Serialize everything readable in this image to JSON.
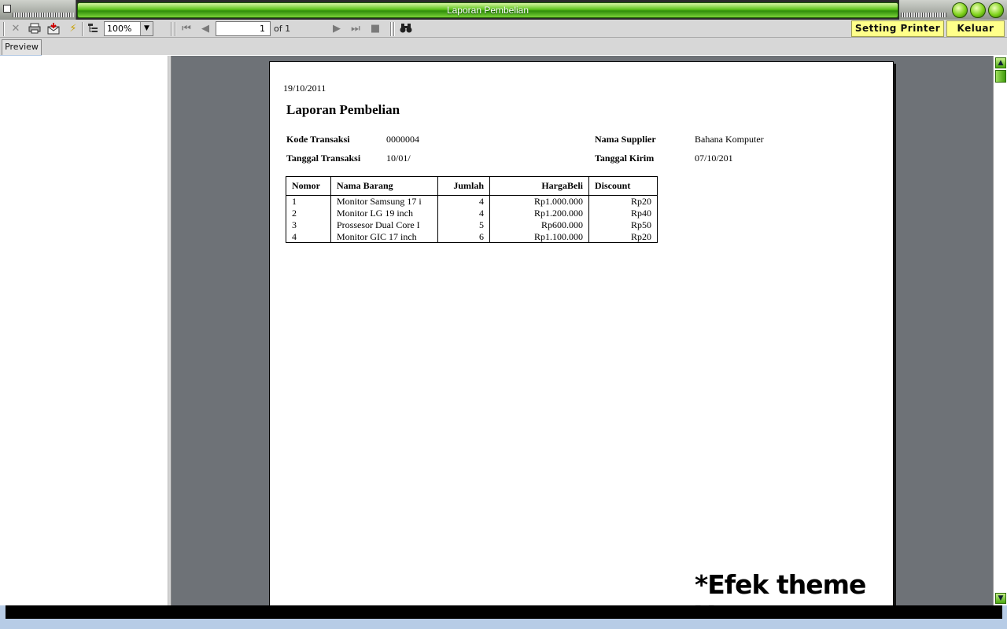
{
  "window": {
    "title": "Laporan Pembelian"
  },
  "toolbar": {
    "zoom": "100%",
    "page_current": "1",
    "page_of": "of 1",
    "setting_printer_label": "Setting Printer",
    "exit_label": "Keluar"
  },
  "tabs": [
    {
      "label": "Preview"
    }
  ],
  "report": {
    "date": "19/10/2011",
    "title": "Laporan Pembelian",
    "kode_label": "Kode Transaksi",
    "kode_value": "0000004",
    "tanggal_label": "Tanggal Transaksi",
    "tanggal_value": "10/01/",
    "supplier_label": "Nama Supplier",
    "supplier_value": "Bahana Komputer",
    "kirim_label": "Tanggal Kirim",
    "kirim_value": "07/10/201",
    "columns": [
      "Nomor",
      "Nama Barang",
      "Jumlah",
      "HargaBeli",
      "Discount"
    ],
    "rows": [
      [
        "1",
        "Monitor Samsung 17 i",
        "4",
        "Rp1.000.000",
        "Rp20"
      ],
      [
        "2",
        "Monitor LG 19 inch",
        "4",
        "Rp1.200.000",
        "Rp40"
      ],
      [
        "3",
        "Prossesor Dual Core I",
        "5",
        "Rp600.000",
        "Rp50"
      ],
      [
        "4",
        "Monitor GIC 17 inch",
        "6",
        "Rp1.100.000",
        "Rp20"
      ]
    ]
  },
  "watermark": "*Efek theme XP",
  "icons": {
    "close": "close-icon",
    "print": "printer-icon",
    "export": "export-icon",
    "refresh": "lightning-icon",
    "tree": "group-tree-icon",
    "first": "first-page-icon",
    "prev": "prev-page-icon",
    "next": "next-page-icon",
    "last": "last-page-icon",
    "stop": "stop-icon",
    "search": "binoculars-icon"
  },
  "colors": {
    "title_green": "#5cc41a",
    "action_button": "#ffff8a",
    "viewer_bg": "#6e7277"
  }
}
